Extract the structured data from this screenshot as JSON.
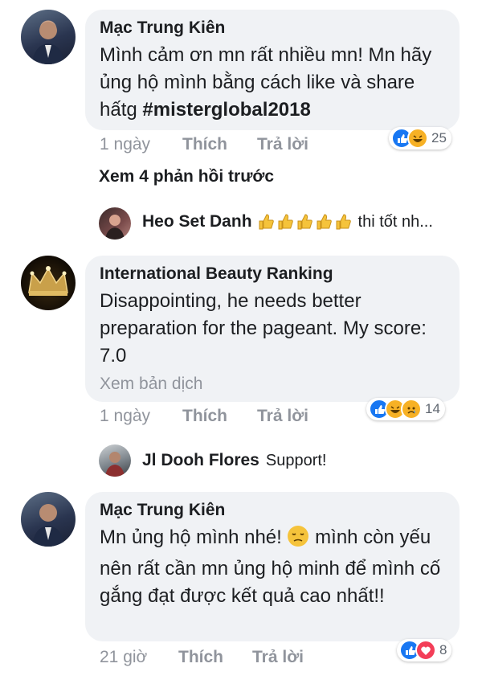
{
  "comments": [
    {
      "author": "Mạc Trung Kiên",
      "text_plain": "Mình cảm ơn mn rất nhiều mn! Mn hãy ủng hộ mình bằng cách like và share hấtg ",
      "hashtag": "#misterglobal2018",
      "time": "1 ngày",
      "like": "Thích",
      "reply": "Trả lời",
      "reactions": [
        "like-icon",
        "haha-icon"
      ],
      "reaction_count": "25"
    },
    {
      "author": "International Beauty Ranking",
      "text": "Disappointing, he needs better preparation for the pageant. My score: 7.0",
      "see_translation": "Xem bản dịch",
      "time": "1 ngày",
      "like": "Thích",
      "reply": "Trả lời",
      "reactions": [
        "like-icon",
        "haha-icon",
        "sad-icon"
      ],
      "reaction_count": "14"
    },
    {
      "author": "Mạc Trung Kiên",
      "text_part1": "Mn ủng hộ mình nhé! ",
      "text_part2": " mình còn yếu nên rất cần mn ủng hộ minh để mình cố gắng đạt được kết quả cao nhất!!",
      "time": "21 giờ",
      "like": "Thích",
      "reply": "Trả lời",
      "reactions": [
        "like-icon",
        "love-icon"
      ],
      "reaction_count": "8"
    }
  ],
  "previous_replies": "Xem 4 phản hồi trước",
  "replies": [
    {
      "author": "Heo Set Danh",
      "text": "thi tốt nh..."
    },
    {
      "author": "Jl Dooh Flores",
      "text": "Support!"
    }
  ],
  "colors": {
    "bubble": "#f0f2f5",
    "meta_text": "#90949c",
    "like_blue": "#1877f2",
    "love_red": "#f33e58",
    "haha_yellow": "#f7b125"
  }
}
